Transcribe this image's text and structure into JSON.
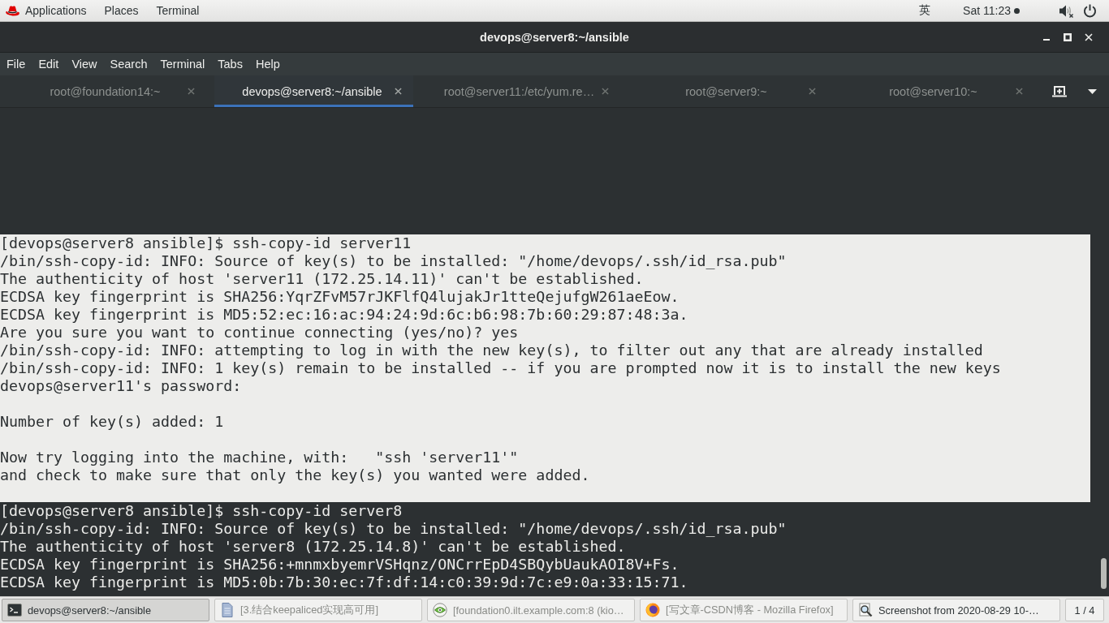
{
  "top_bar": {
    "menus": [
      "Applications",
      "Places",
      "Terminal"
    ],
    "input_method": "英",
    "clock": "Sat 11:23"
  },
  "window": {
    "title": "devops@server8:~/ansible",
    "menu": [
      "File",
      "Edit",
      "View",
      "Search",
      "Terminal",
      "Tabs",
      "Help"
    ],
    "tabs": [
      {
        "label": "root@foundation14:~",
        "selected": false
      },
      {
        "label": "devops@server8:~/ansible",
        "selected": true
      },
      {
        "label": "root@server11:/etc/yum.re…",
        "selected": false
      },
      {
        "label": "root@server9:~",
        "selected": false
      },
      {
        "label": "root@server10:~",
        "selected": false
      }
    ]
  },
  "terminal": {
    "blocks": [
      {
        "selected": true,
        "paragraphs": [
          [
            "[devops@server8 ansible]$ ssh-copy-id server11",
            "/bin/ssh-copy-id: INFO: Source of key(s) to be installed: \"/home/devops/.ssh/id_rsa.pub\"",
            "The authenticity of host 'server11 (172.25.14.11)' can't be established.",
            "ECDSA key fingerprint is SHA256:YqrZFvM57rJKFlfQ4lujakJr1tteQejufgW261aeEow.",
            "ECDSA key fingerprint is MD5:52:ec:16:ac:94:24:9d:6c:b6:98:7b:60:29:87:48:3a.",
            "Are you sure you want to continue connecting (yes/no)? yes",
            "/bin/ssh-copy-id: INFO: attempting to log in with the new key(s), to filter out any that are already installed",
            "/bin/ssh-copy-id: INFO: 1 key(s) remain to be installed -- if you are prompted now it is to install the new keys",
            "devops@server11's password:"
          ],
          [
            "Number of key(s) added: 1"
          ],
          [
            "Now try logging into the machine, with:   \"ssh 'server11'\"",
            "and check to make sure that only the key(s) you wanted were added."
          ]
        ]
      },
      {
        "selected": false,
        "paragraphs": [
          [
            "[devops@server8 ansible]$ ssh-copy-id server8",
            "/bin/ssh-copy-id: INFO: Source of key(s) to be installed: \"/home/devops/.ssh/id_rsa.pub\"",
            "The authenticity of host 'server8 (172.25.14.8)' can't be established.",
            "ECDSA key fingerprint is SHA256:+mnmxbyemrVSHqnz/ONCrrEpD4SBQybUaukAOI8V+Fs.",
            "ECDSA key fingerprint is MD5:0b:7b:30:ec:7f:df:14:c0:39:9d:7c:e9:0a:33:15:71."
          ]
        ]
      }
    ]
  },
  "taskbar": {
    "items": [
      {
        "label": "devops@server8:~/ansible",
        "kind": "terminal",
        "selected": true,
        "minimized": false
      },
      {
        "label": "[3.结合keepaliced实现高可用]",
        "kind": "document",
        "selected": false,
        "minimized": true
      },
      {
        "label": "[foundation0.ilt.example.com:8 (kio…",
        "kind": "viewer",
        "selected": false,
        "minimized": true
      },
      {
        "label": "[写文章-CSDN博客 - Mozilla Firefox]",
        "kind": "browser",
        "selected": false,
        "minimized": true
      },
      {
        "label": "Screenshot from 2020-08-29 10-…",
        "kind": "screenshot",
        "selected": false,
        "minimized": false
      }
    ],
    "workspace": "1 / 4"
  }
}
